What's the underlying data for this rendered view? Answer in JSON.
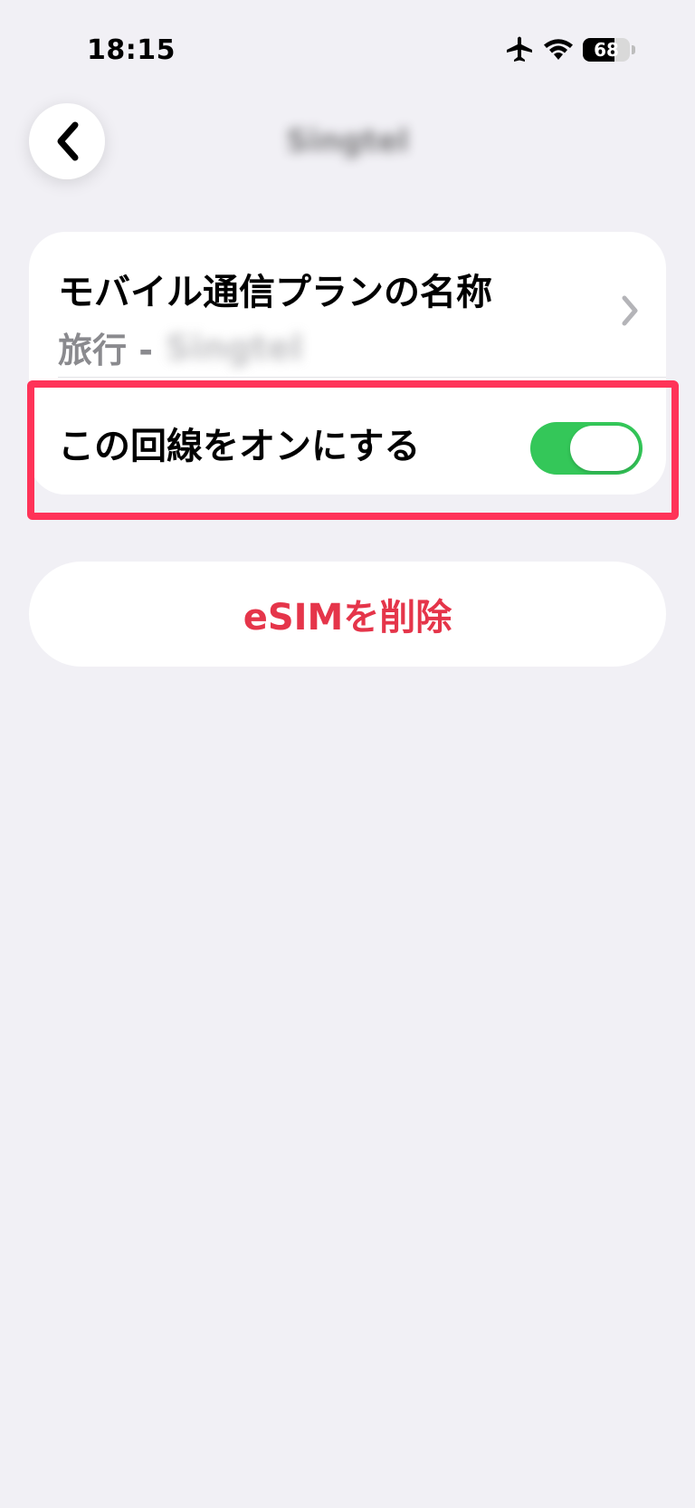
{
  "status_bar": {
    "time": "18:15",
    "battery_level": "68",
    "icons": [
      "airplane-icon",
      "wifi-icon",
      "battery-icon"
    ]
  },
  "nav": {
    "title": "Singtel",
    "back_icon": "chevron-left-icon"
  },
  "plan": {
    "title": "モバイル通信プランの名称",
    "subtitle_prefix": "旅行 -",
    "subtitle_name": "Singtel",
    "chevron_icon": "chevron-right-icon"
  },
  "line_toggle": {
    "label": "この回線をオンにする",
    "state": "on"
  },
  "delete": {
    "label": "eSIMを削除"
  },
  "colors": {
    "background": "#f1f0f5",
    "toggle_on": "#34c759",
    "destructive": "#e5354a",
    "highlight": "#ff3358"
  }
}
